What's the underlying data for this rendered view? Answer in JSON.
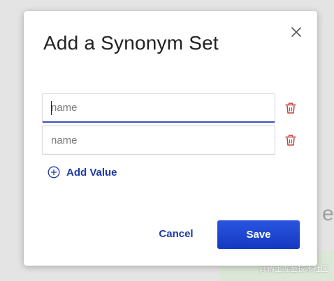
{
  "background": {
    "partial_text": "et",
    "watermark": "@稀土掘金技术社区"
  },
  "modal": {
    "title": "Add a Synonym Set",
    "close_icon": "close-icon",
    "values": [
      {
        "value": "",
        "placeholder": "name",
        "focused": true,
        "delete_icon": "trash-icon"
      },
      {
        "value": "",
        "placeholder": "name",
        "focused": false,
        "delete_icon": "trash-icon"
      }
    ],
    "add_value_label": "Add Value",
    "add_value_icon": "plus-circle-icon",
    "cancel_label": "Cancel",
    "save_label": "Save"
  },
  "colors": {
    "accent": "#1c3aa9",
    "primary_button": "#1f45d0",
    "focus_underline": "#3d4fc5",
    "delete_icon": "#c8403a"
  }
}
